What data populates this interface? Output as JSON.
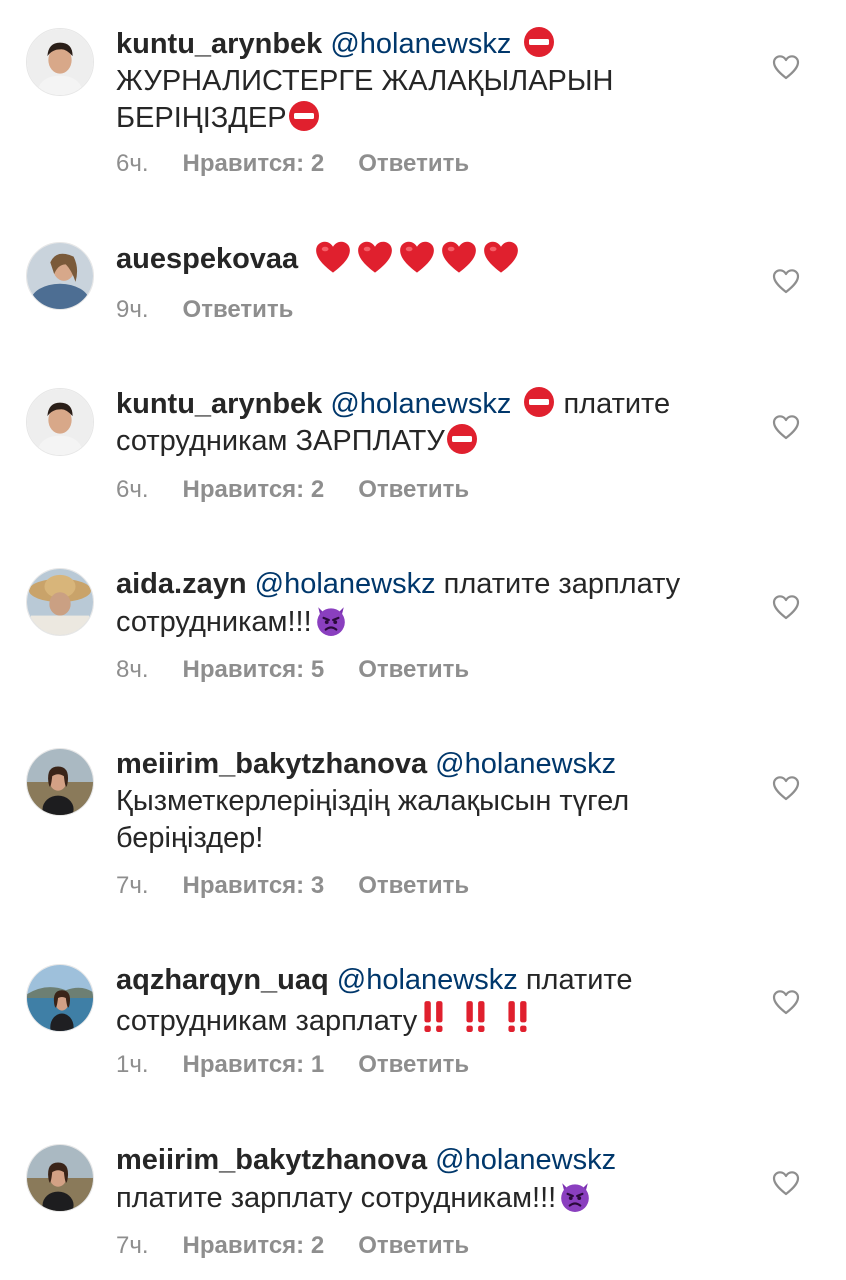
{
  "comments": [
    {
      "username": "kuntu_arynbek",
      "mention": "@holanewskz",
      "lines": [
        "ЖУРНАЛИСТЕРГЕ ЖАЛАҚЫЛАРЫН",
        "БЕРІҢІЗДЕР"
      ],
      "time": "6ч.",
      "likes": "Нравится: 2",
      "reply": "Ответить",
      "avatar_icon": "avatar-young-man",
      "emoji": [
        "no-entry",
        "no-entry"
      ]
    },
    {
      "username": "auespekovaa",
      "time": "9ч.",
      "reply": "Ответить",
      "avatar_icon": "avatar-woman-denim",
      "emoji": [
        "red-heart",
        "red-heart",
        "red-heart",
        "red-heart",
        "red-heart"
      ]
    },
    {
      "username": "kuntu_arynbek",
      "mention": "@holanewskz",
      "text_after": "платите",
      "line2": "сотрудникам ЗАРПЛАТУ",
      "time": "6ч.",
      "likes": "Нравится: 2",
      "reply": "Ответить",
      "avatar_icon": "avatar-young-man",
      "emoji": [
        "no-entry",
        "no-entry"
      ]
    },
    {
      "username": "aida.zayn",
      "mention": "@holanewskz",
      "text_after": "платите зарплату",
      "line2": "сотрудникам!!!",
      "time": "8ч.",
      "likes": "Нравится: 5",
      "reply": "Ответить",
      "avatar_icon": "avatar-woman-hat",
      "emoji": [
        "angry-devil"
      ]
    },
    {
      "username": "meiirim_bakytzhanova",
      "mention": "@holanewskz",
      "line2": "Қызметкерлеріңіздің жалақысын түгел",
      "line3": "беріңіздер!",
      "time": "7ч.",
      "likes": "Нравится: 3",
      "reply": "Ответить",
      "avatar_icon": "avatar-woman-landscape"
    },
    {
      "username": "aqzharqyn_uaq",
      "mention": "@holanewskz",
      "text_after": "платите",
      "line2": "сотрудникам зарплату",
      "time": "1ч.",
      "likes": "Нравится: 1",
      "reply": "Ответить",
      "avatar_icon": "avatar-woman-sea",
      "emoji": [
        "double-exclamation",
        "double-exclamation",
        "double-exclamation"
      ]
    },
    {
      "username": "meiirim_bakytzhanova",
      "mention": "@holanewskz",
      "line2": "платите зарплату сотрудникам!!!",
      "time": "7ч.",
      "likes": "Нравится: 2",
      "reply": "Ответить",
      "avatar_icon": "avatar-woman-landscape",
      "emoji": [
        "angry-devil"
      ]
    }
  ],
  "colors": {
    "username": "#262626",
    "mention": "#00376b",
    "meta": "#8e8e8e",
    "heart_outline": "#8e8e8e",
    "emoji_red": "#e0202e",
    "devil_purple": "#8a3fbf"
  }
}
